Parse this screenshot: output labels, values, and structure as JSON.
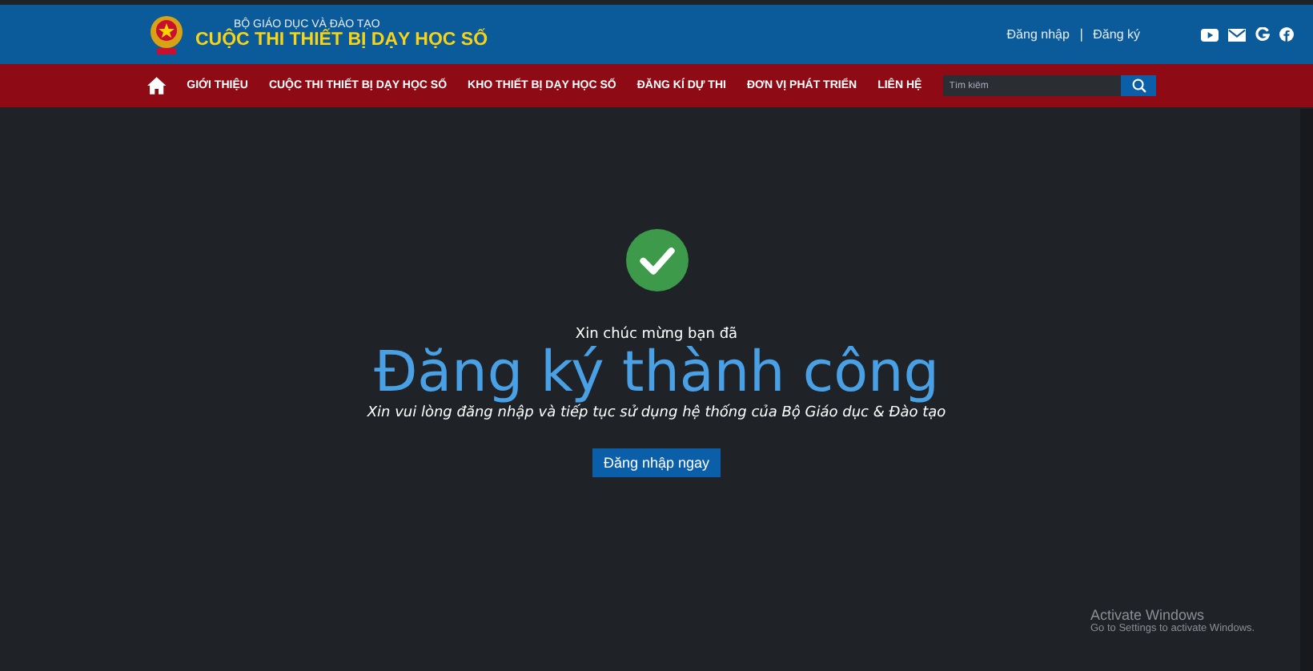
{
  "header": {
    "ministry": "BỘ GIÁO DỤC VÀ ĐÀO TẠO",
    "site_title": "CUỘC THI THIẾT BỊ DẠY HỌC SỐ",
    "auth_links": [
      "Đăng nhập",
      "Đăng ký"
    ],
    "separator": "|"
  },
  "nav": {
    "items": [
      "GIỚI THIỆU",
      "CUỘC THI THIẾT BỊ DẠY HỌC SỐ",
      "KHO THIẾT BỊ DẠY HỌC SỐ",
      "ĐĂNG KÍ DỰ THI",
      "ĐƠN VỊ PHÁT TRIỂN",
      "LIÊN HỆ"
    ],
    "search": {
      "placeholder": "Tìm kiếm"
    }
  },
  "success": {
    "greeting": "Xin chúc mừng bạn đã",
    "headline": "Đăng ký thành công",
    "message": "Xin vui lòng đăng nhập và tiếp tục sử dụng hệ thống của Bộ Giáo dục & Đào tạo",
    "button": "Đăng nhập ngay"
  },
  "activation_notice": {
    "title": "Activate Windows",
    "subtitle": "Go to Settings to activate Windows."
  }
}
